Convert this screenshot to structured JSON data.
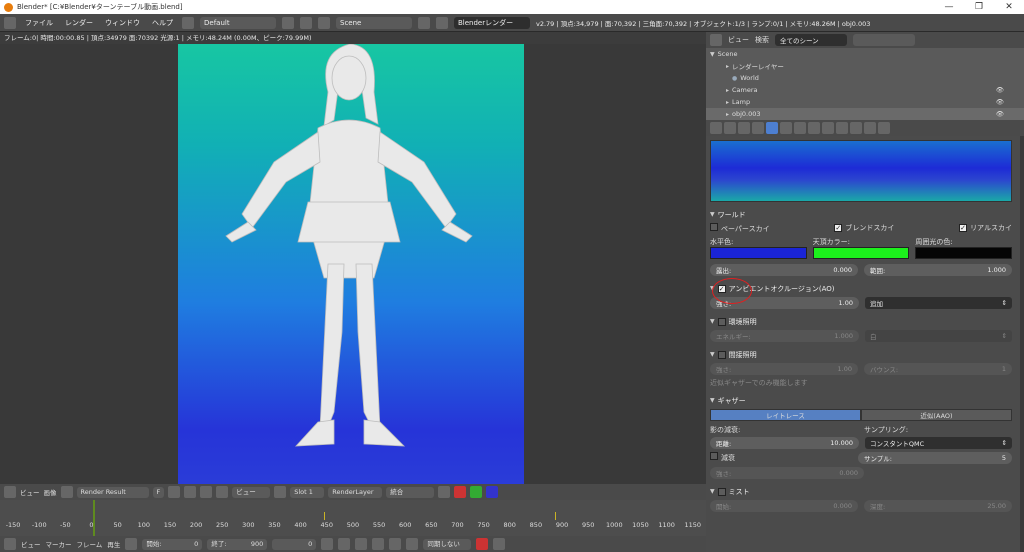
{
  "window": {
    "title": "Blender* [C:¥Blender¥ターンテーブル動画.blend]",
    "controls": [
      "—",
      "❐",
      "✕"
    ]
  },
  "menubar": {
    "menus": [
      "ファイル",
      "レンダー",
      "ウィンドウ",
      "ヘルプ"
    ],
    "screen_layout": "Default",
    "scene": "Scene",
    "engine": "Blenderレンダー",
    "stats": "v2.79 | 頂点:34,979 | 面:70,392 | 三角面:70,392 | オブジェクト:1/3 | ランプ:0/1 | メモリ:48.26M | obj0.003"
  },
  "render_info": "フレーム:0| 時間:00:00.85 | 頂点:34979 面:70392 光源:1 | メモリ:48.24M (0.00M、ピーク:79.99M)",
  "image_editor_bar": {
    "view": "ビュー",
    "image": "画像",
    "image_name": "Render Result",
    "f_label": "F",
    "view2": "ビュー",
    "slot": "Slot 1",
    "layer": "RenderLayer",
    "pass": "統合"
  },
  "timeline": {
    "ticks": [
      "-150",
      "-100",
      "-50",
      "0",
      "50",
      "100",
      "150",
      "200",
      "250",
      "300",
      "350",
      "400",
      "450",
      "500",
      "550",
      "600",
      "650",
      "700",
      "750",
      "800",
      "850",
      "900",
      "950",
      "1000",
      "1050",
      "1100",
      "1150"
    ],
    "menus": [
      "ビュー",
      "マーカー",
      "フレーム",
      "再生"
    ],
    "start_label": "開始:",
    "start": "0",
    "end_label": "終了:",
    "end": "900",
    "current": "0",
    "sync": "同期しない"
  },
  "outliner": {
    "view": "ビュー",
    "search_label": "検索",
    "filter": "全てのシーン",
    "items": [
      "Scene",
      "レンダーレイヤー",
      "World",
      "Camera",
      "Lamp",
      "obj0.003"
    ]
  },
  "world_panel": {
    "title": "ワールド",
    "paper_sky": "ペーパースカイ",
    "paper_sky_checked": false,
    "blend_sky": "ブレンドスカイ",
    "blend_sky_checked": true,
    "real_sky": "リアルスカイ",
    "real_sky_checked": true,
    "horizon_label": "水平色:",
    "horizon_color": "#1a24d6",
    "zenith_label": "天頂カラー:",
    "zenith_color": "#1cf01c",
    "ambient_label": "周囲光の色:",
    "ambient_color": "#050505",
    "exposure_label": "露出:",
    "exposure": "0.000",
    "range_label": "範囲:",
    "range": "1.000"
  },
  "ao_panel": {
    "title": "アンビエントオクルージョン(AO)",
    "checked": true,
    "strength_label": "強さ:",
    "strength": "1.00",
    "blend": "追加"
  },
  "env_panel": {
    "title": "環境照明",
    "checked": false,
    "energy_label": "エネルギー:",
    "energy": "1.000",
    "color": "白"
  },
  "indirect_panel": {
    "title": "間接照明",
    "checked": false,
    "factor_label": "強さ:",
    "factor": "1.00",
    "bounces_label": "バウンス:",
    "bounces": "1",
    "note": "近似ギャザーでのみ機能します"
  },
  "gather_panel": {
    "title": "ギャザー",
    "tab_raytrace": "レイトレース",
    "tab_approx": "近似(AAO)",
    "attenuation_label": "影の減衰:",
    "sampling_label": "サンプリング:",
    "distance_label": "距離:",
    "distance": "10.000",
    "sampling_method": "コンスタントQMC",
    "falloff_label": "減衰",
    "samples_label": "サンプル:",
    "samples": "5",
    "falloff_strength_label": "強さ:",
    "falloff_strength": "0.000"
  },
  "mist_panel": {
    "title": "ミスト",
    "start_label": "開始:",
    "start": "0.000",
    "depth_label": "深度:",
    "depth": "25.00"
  }
}
